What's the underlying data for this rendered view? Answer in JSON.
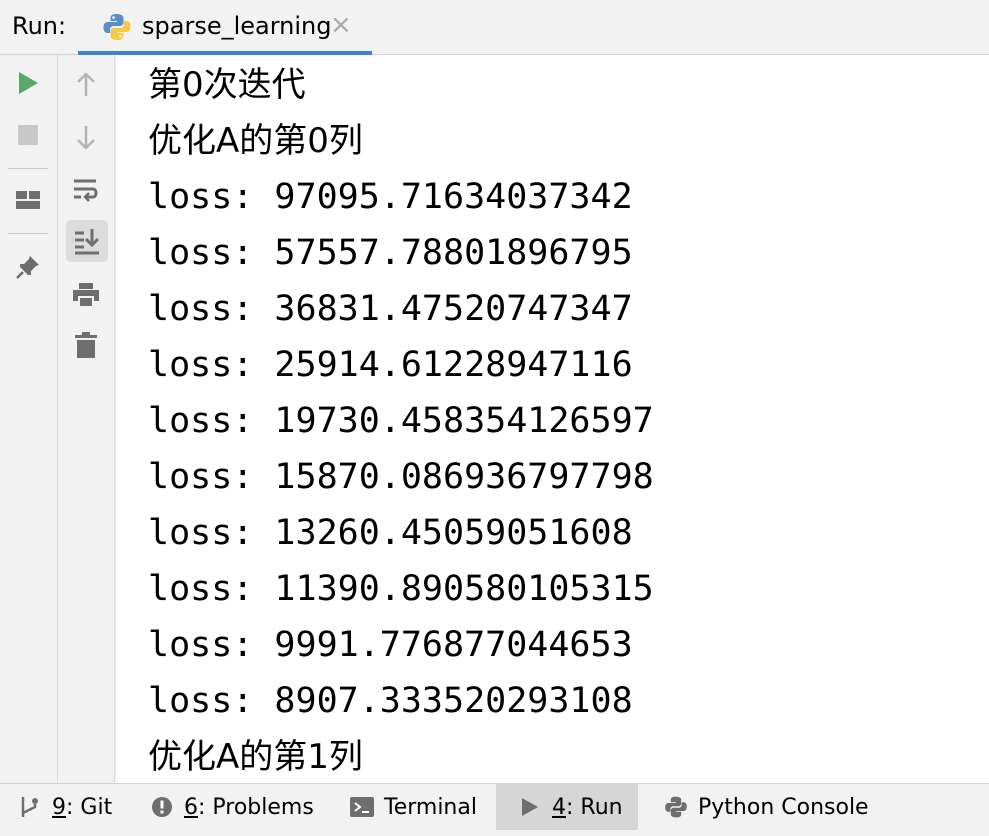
{
  "header": {
    "run_label": "Run:",
    "tab_label": "sparse_learning",
    "tab_close": "×"
  },
  "toolbar": {
    "left": [
      "run-icon",
      "stop-icon",
      "layout-icon",
      "pin-icon"
    ],
    "right": [
      "up-arrow-icon",
      "down-arrow-icon",
      "soft-wrap-icon",
      "scroll-to-end-icon",
      "print-icon",
      "trash-icon"
    ]
  },
  "console": {
    "lines": [
      "第0次迭代",
      "优化A的第0列",
      "loss: 97095.71634037342",
      "loss: 57557.78801896795",
      "loss: 36831.47520747347",
      "loss: 25914.61228947116",
      "loss: 19730.458354126597",
      "loss: 15870.086936797798",
      "loss: 13260.45059051608",
      "loss: 11390.890580105315",
      "loss: 9991.776877044653",
      "loss: 8907.333520293108",
      "优化A的第1列"
    ]
  },
  "bottom": {
    "git_num": "9",
    "git_label": ": Git",
    "problems_num": "6",
    "problems_label": ": Problems",
    "terminal_label": "Terminal",
    "run_num": "4",
    "run_label": ": Run",
    "python_console_label": "Python Console"
  },
  "colors": {
    "accent": "#4083c9",
    "run_green": "#59a869",
    "icon_gray": "#6e6e6e"
  }
}
